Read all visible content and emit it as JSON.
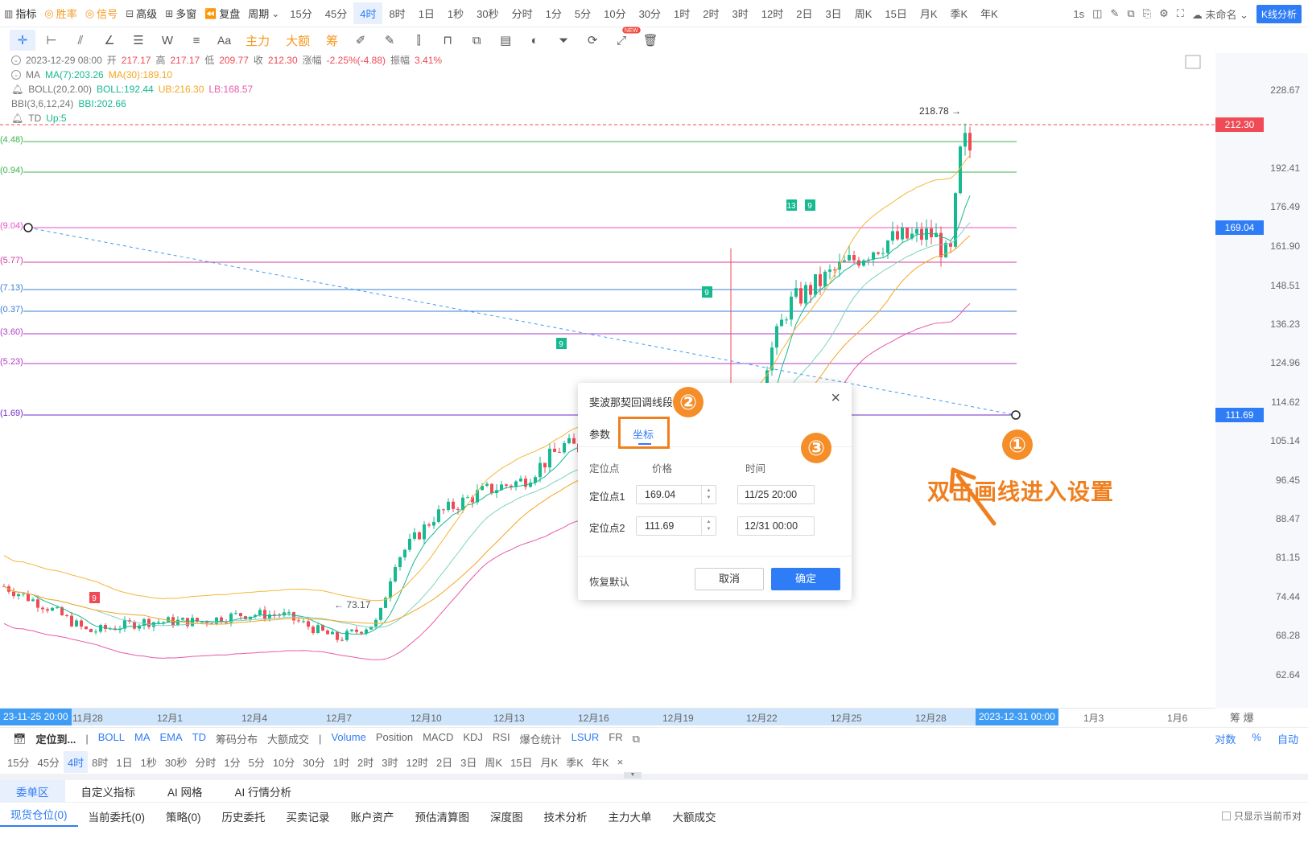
{
  "toolbar": {
    "indicators": "指标",
    "win_rate": "胜率",
    "signal": "信号",
    "advanced": "高级",
    "multi_window": "多窗",
    "replay": "复盘",
    "period": "周期",
    "periods": [
      "15分",
      "45分",
      "4时",
      "8时",
      "1日",
      "1秒",
      "30秒",
      "分时",
      "1分",
      "5分",
      "10分",
      "30分",
      "1时",
      "2时",
      "3时",
      "12时",
      "2日",
      "3日",
      "周K",
      "15日",
      "月K",
      "季K",
      "年K"
    ],
    "active_period": "4时",
    "right_interval": "1s",
    "unnamed": "未命名",
    "kline_analysis": "K线分析"
  },
  "drawbar": {
    "text_tool": "Aa",
    "main_force": "主力",
    "big_amount": "大额",
    "chips": "筹",
    "new_badge": "NEW"
  },
  "legend": {
    "date": "2023-12-29 08:00",
    "open_label": "开",
    "open": "217.17",
    "high_label": "高",
    "high": "217.17",
    "low_label": "低",
    "low": "209.77",
    "close_label": "收",
    "close": "212.30",
    "change_label": "涨幅",
    "change": "-2.25%(-4.88)",
    "amp_label": "振幅",
    "amp": "3.41%",
    "ma_name": "MA",
    "ma7": "MA(7):203.26",
    "ma30": "MA(30):189.10",
    "boll_name": "BOLL(20,2.00)",
    "boll": "BOLL:192.44",
    "ub": "UB:216.30",
    "lb": "LB:168.57",
    "bbi_name": "BBI(3,6,12,24)",
    "bbi": "BBI:202.66",
    "td_name": "TD",
    "td": "Up:5"
  },
  "chart_data": {
    "type": "candlestick",
    "y_ticks": [
      "228.67",
      "192.41",
      "176.49",
      "161.90",
      "148.51",
      "136.23",
      "124.96",
      "114.62",
      "105.14",
      "96.45",
      "88.47",
      "81.15",
      "74.44",
      "68.28",
      "62.64"
    ],
    "current_price": "212.30",
    "fib_point1_price": "169.04",
    "fib_point2_price": "111.69",
    "high_marker": "218.78",
    "low_marker": "73.17",
    "fib_levels": [
      "(4.48)",
      "(0.94)",
      "(9.04)",
      "(5.77)",
      "(7.13)",
      "(0.37)",
      "(3.60)",
      "(5.23)",
      "(1.69)"
    ],
    "fib_colors": [
      "#3ab54a",
      "#3ab54a",
      "#ea4fc9",
      "#d13c9c",
      "#3a7fd4",
      "#3a7fd4",
      "#b23cc8",
      "#b23cc8",
      "#6f2bc4"
    ],
    "td_markers": [
      "9",
      "9",
      "9",
      "13",
      "9"
    ],
    "x_labels": [
      "11月28",
      "12月1",
      "12月4",
      "12月7",
      "12月10",
      "12月13",
      "12月16",
      "12月19",
      "12月22",
      "12月25",
      "12月28",
      "1月3",
      "1月6"
    ],
    "x_start": "23-11-25 20:00",
    "x_end": "2023-12-31 00:00",
    "axis_right": "筹 爆"
  },
  "indicator_bar": {
    "locate": "定位到...",
    "main_items": [
      "BOLL",
      "MA",
      "EMA",
      "TD",
      "筹码分布",
      "大额成交"
    ],
    "sub_items": [
      "Volume",
      "Position",
      "MACD",
      "KDJ",
      "RSI",
      "爆仓统计",
      "LSUR",
      "FR"
    ],
    "right_items": [
      "对数",
      "%",
      "自动"
    ]
  },
  "period_bar": [
    "15分",
    "45分",
    "4时",
    "8时",
    "1日",
    "1秒",
    "30秒",
    "分时",
    "1分",
    "5分",
    "10分",
    "30分",
    "1时",
    "2时",
    "3时",
    "12时",
    "2日",
    "3日",
    "周K",
    "15日",
    "月K",
    "季K",
    "年K"
  ],
  "bottom_tabs": [
    "委单区",
    "自定义指标",
    "AI 网格",
    "AI 行情分析"
  ],
  "order_tabs": [
    "现货仓位(0)",
    "当前委托(0)",
    "策略(0)",
    "历史委托",
    "买卖记录",
    "账户资产",
    "预估清算图",
    "深度图",
    "技术分析",
    "主力大单",
    "大额成交"
  ],
  "only_current": "只显示当前币对",
  "dialog": {
    "title": "斐波那契回调线段",
    "tab_params": "参数",
    "tab_coords": "坐标",
    "col_point": "定位点",
    "col_price": "价格",
    "col_time": "时间",
    "p1_label": "定位点1",
    "p1_price": "169.04",
    "p1_time": "11/25 20:00",
    "p2_label": "定位点2",
    "p2_price": "111.69",
    "p2_time": "12/31 00:00",
    "reset": "恢复默认",
    "cancel": "取消",
    "ok": "确定"
  },
  "annotations": {
    "n1": "①",
    "n2": "②",
    "n3": "③",
    "text": "双击画线进入设置"
  }
}
